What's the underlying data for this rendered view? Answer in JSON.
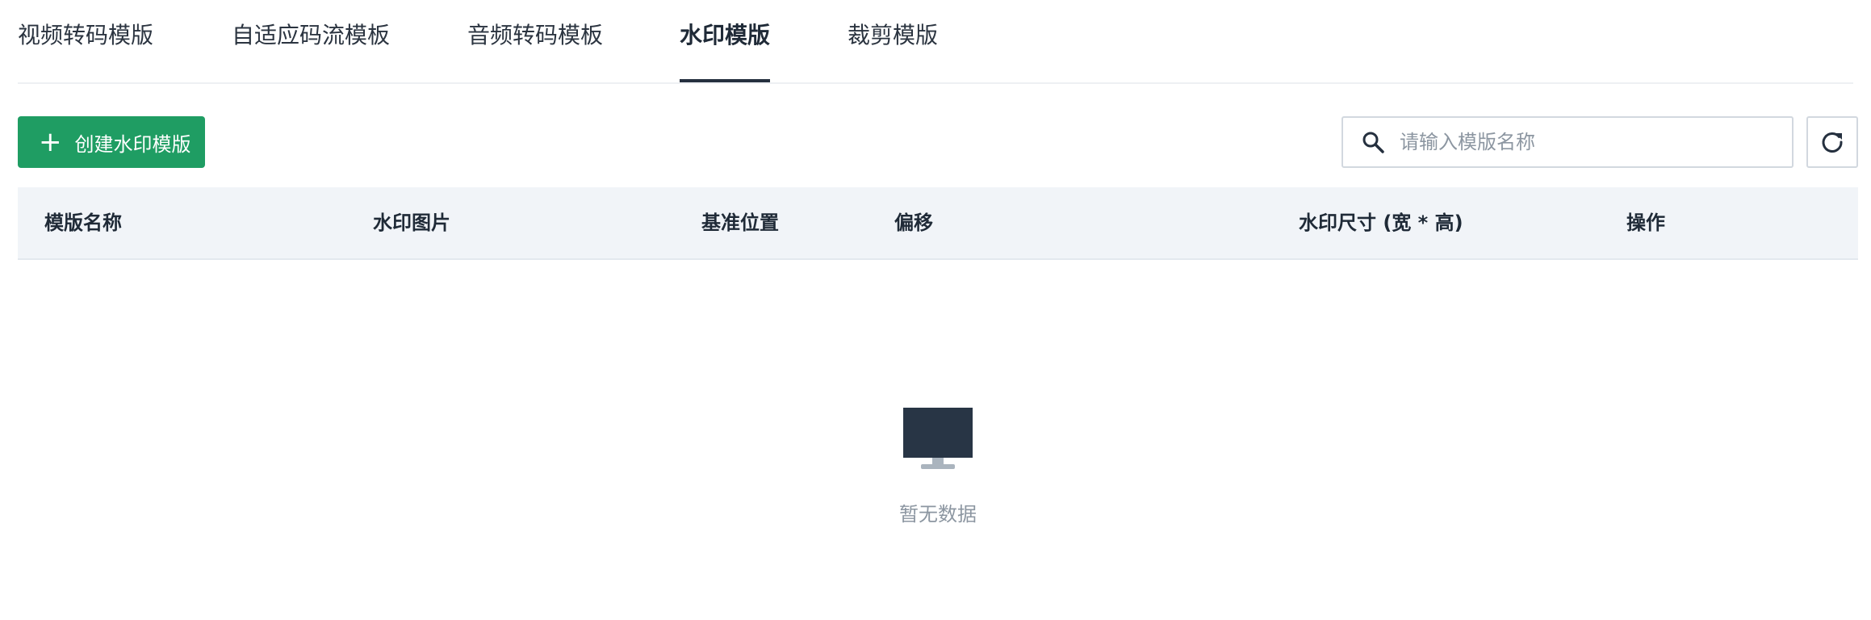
{
  "tabs": [
    {
      "label": "视频转码模版",
      "active": false
    },
    {
      "label": "自适应码流模板",
      "active": false
    },
    {
      "label": "音频转码模板",
      "active": false
    },
    {
      "label": "水印模版",
      "active": true
    },
    {
      "label": "裁剪模版",
      "active": false
    }
  ],
  "toolbar": {
    "create_label": "创建水印模版",
    "search_placeholder": "请输入模版名称",
    "search_value": ""
  },
  "table": {
    "columns": [
      "模版名称",
      "水印图片",
      "基准位置",
      "偏移",
      "水印尺寸 (宽 * 高)",
      "操作"
    ],
    "rows": []
  },
  "empty_state": {
    "text": "暂无数据",
    "icon": "monitor-icon"
  },
  "colors": {
    "primary": "#1f9d63",
    "tab_indicator": "#25303f",
    "header_bg": "#f1f4f8",
    "muted_text": "#8c96a1"
  }
}
